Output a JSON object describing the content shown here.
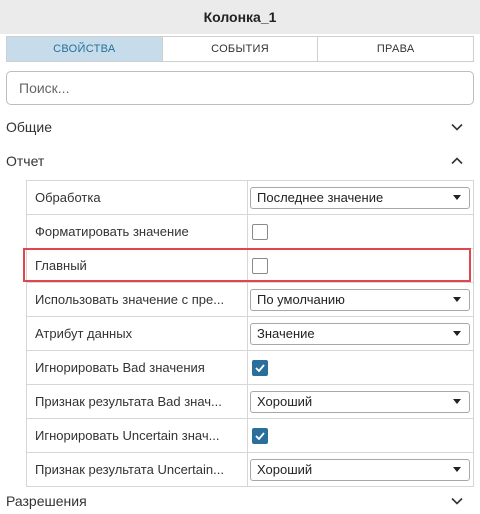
{
  "header": {
    "title": "Колонка_1"
  },
  "tabs": [
    {
      "label": "СВОЙСТВА"
    },
    {
      "label": "СОБЫТИЯ"
    },
    {
      "label": "ПРАВА"
    }
  ],
  "search": {
    "placeholder": "Поиск..."
  },
  "sections": {
    "general": "Общие",
    "report": "Отчет",
    "permissions": "Разрешения"
  },
  "rows": [
    {
      "label": "Обработка",
      "select": "Последнее значение"
    },
    {
      "label": "Форматировать значение",
      "checked": false
    },
    {
      "label": "Главный",
      "checked": false
    },
    {
      "label": "Использовать значение с пре...",
      "select": "По умолчанию"
    },
    {
      "label": "Атрибут данных",
      "select": "Значение"
    },
    {
      "label": "Игнорировать Bad значения",
      "checked": true
    },
    {
      "label": "Признак результата Bad знач...",
      "select": "Хороший"
    },
    {
      "label": "Игнорировать Uncertain знач...",
      "checked": true
    },
    {
      "label": "Признак результата Uncertain...",
      "select": "Хороший"
    }
  ],
  "colors": {
    "accent": "#2a6f9b",
    "tab_active_bg": "#c6dcea",
    "highlight": "#e0474c"
  }
}
